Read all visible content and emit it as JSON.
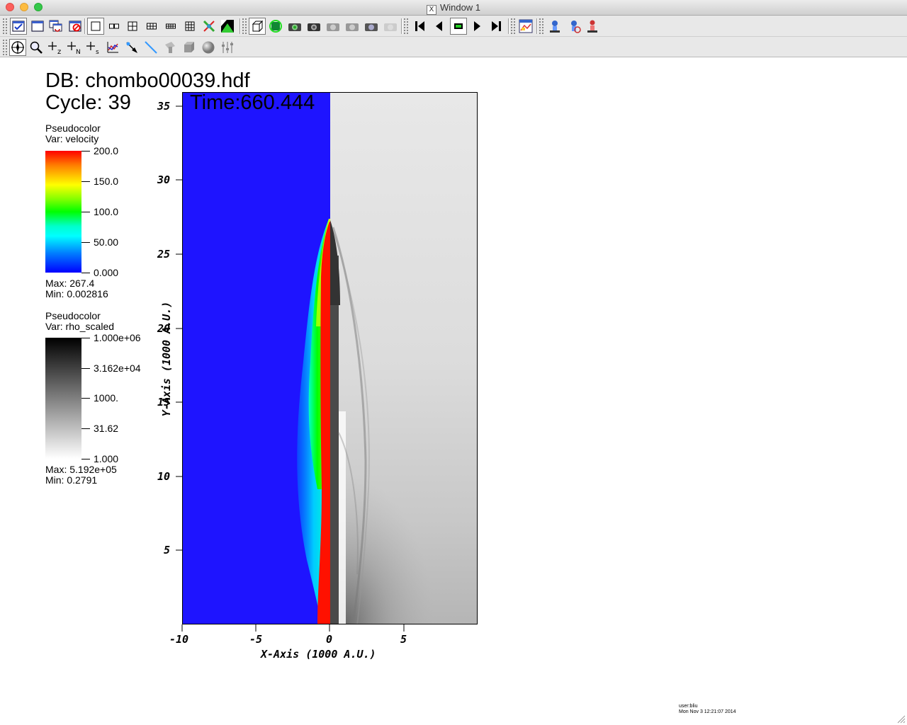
{
  "window": {
    "title": "Window 1"
  },
  "toolbar1": {
    "icons": [
      "window-active-icon",
      "new-window-icon",
      "clone-window-icon",
      "delete-window-icon",
      "layout-1x1-icon",
      "layout-1x2-icon",
      "layout-2x2-icon",
      "layout-2x3-icon",
      "layout-2x4-icon",
      "layout-3x3-icon",
      "lock-view-icon",
      "invert-background-icon",
      "perspective-cube-icon",
      "spin-mode-icon",
      "camera-view-icon",
      "save-view-camera-icon",
      "camera-icon-3",
      "camera-icon-4",
      "camera-icon-5",
      "camera-icon-6",
      "animation-reverse-end-icon",
      "animation-play-reverse-icon",
      "animation-stop-icon",
      "animation-play-icon",
      "animation-forward-end-icon",
      "lineout-icon",
      "lighting-icon-1",
      "lighting-icon-2",
      "lighting-icon-3"
    ]
  },
  "toolbar2": {
    "icons": [
      "navigate-mode-icon",
      "zoom-mode-icon",
      "pick-z-icon",
      "pick-n-icon",
      "pick-s-icon",
      "lineout-mode-icon",
      "pick-mode-icon",
      "line-tool-icon",
      "plane-tool-icon",
      "box-tool-icon",
      "sphere-tool-icon",
      "axis-restriction-icon"
    ],
    "pick_letters": [
      "z",
      "N",
      "s"
    ]
  },
  "plot": {
    "db_label": "DB: chombo00039.hdf",
    "cycle_label": "Cycle: 39",
    "time_label": "Time:660.444",
    "legend_velocity": {
      "title": "Pseudocolor",
      "var": "Var: velocity",
      "ticks": [
        "200.0",
        "150.0",
        "100.0",
        "50.00",
        "0.000"
      ],
      "max": "Max:  267.4",
      "min": "Min:  0.002816",
      "colors": [
        "#ff0000",
        "#ff7f00",
        "#ffff00",
        "#00ff00",
        "#00ffff",
        "#007fff",
        "#0000ff"
      ]
    },
    "legend_rho": {
      "title": "Pseudocolor",
      "var": "Var: rho_scaled",
      "ticks": [
        "1.000e+06",
        "3.162e+04",
        "1000.",
        "31.62",
        "1.000"
      ],
      "max": "Max:  5.192e+05",
      "min": "Min:  0.2791"
    },
    "x_axis": {
      "title": "X-Axis (1000 A.U.)",
      "ticks": [
        "-10",
        "-5",
        "0",
        "5"
      ],
      "range": [
        -10,
        10
      ]
    },
    "y_axis": {
      "title": "Y-Axis (1000 A.U.)",
      "ticks": [
        "35",
        "30",
        "25",
        "20",
        "15",
        "10",
        "5"
      ],
      "range": [
        0,
        36
      ]
    },
    "user_info": [
      "user:bliu",
      "Mon Nov  3 12:21:07 2014"
    ]
  }
}
